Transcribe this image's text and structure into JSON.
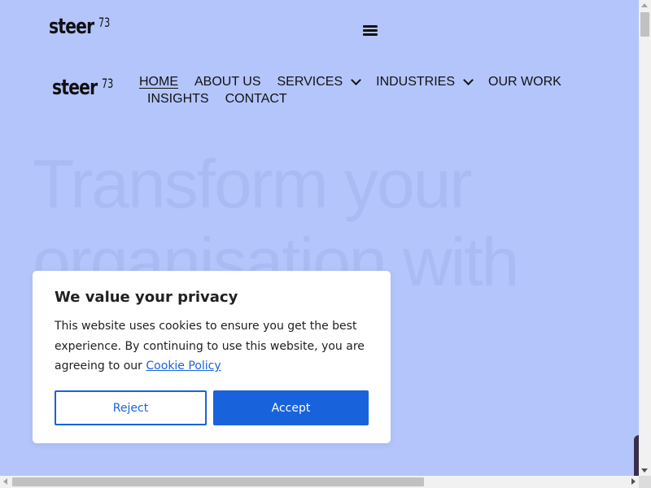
{
  "header": {
    "logo_word": "steer",
    "logo_num": "73",
    "menu_icon": "hamburger-icon"
  },
  "nav": {
    "logo_word": "steer",
    "logo_num": "73",
    "items": [
      {
        "label": "HOME",
        "active": true
      },
      {
        "label": "ABOUT US"
      },
      {
        "label": "SERVICES",
        "dropdown": true
      },
      {
        "label": "INDUSTRIES",
        "dropdown": true
      },
      {
        "label": "OUR WORK"
      },
      {
        "label": "INSIGHTS"
      },
      {
        "label": "CONTACT"
      }
    ]
  },
  "hero": {
    "line1": "Transform your",
    "line2": "organisation with"
  },
  "cookie": {
    "title": "We value your privacy",
    "text": "This website uses cookies to ensure you get the best experience. By continuing to use this website, you are agreeing to our",
    "link": "Cookie Policy",
    "reject": "Reject",
    "accept": "Accept"
  },
  "colors": {
    "background": "#b4c5fc",
    "accent": "#1863dc"
  }
}
